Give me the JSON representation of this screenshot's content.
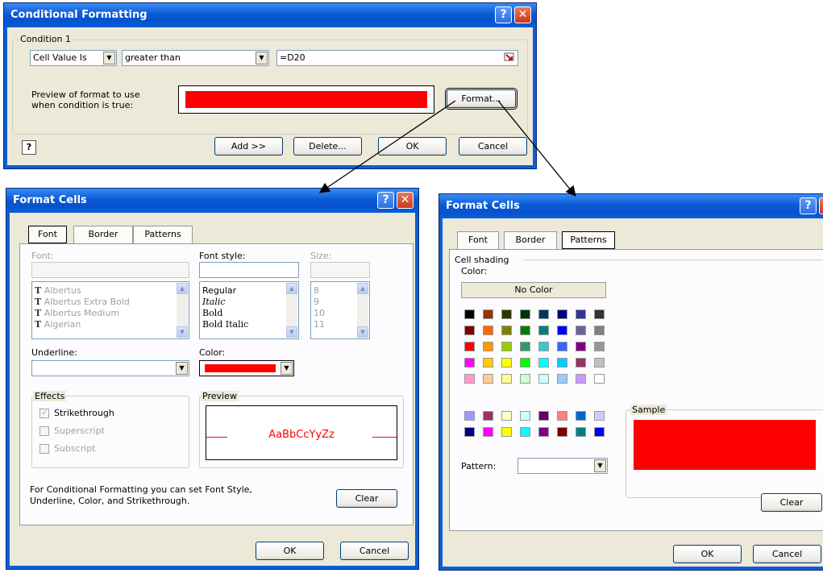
{
  "colors": {
    "accent_red": "#ff0000",
    "title_blue": "#0a5fd6",
    "dialog_bg": "#ece9d8"
  },
  "conditional_formatting": {
    "title": "Conditional Formatting",
    "help_glyph": "?",
    "close_glyph": "✕",
    "condition_label": "Condition 1",
    "operator_type": "Cell Value Is",
    "comparison": "greater than",
    "formula": "=D20",
    "preview_label_1": "Preview of format to use",
    "preview_label_2": "when condition is true:",
    "format_button": "Format...",
    "add_button": "Add >>",
    "delete_button": "Delete...",
    "ok_button": "OK",
    "cancel_button": "Cancel",
    "help_icon_glyph": "?"
  },
  "format_font": {
    "title": "Format Cells",
    "help_glyph": "?",
    "close_glyph": "✕",
    "tabs": [
      "Font",
      "Border",
      "Patterns"
    ],
    "font_label": "Font:",
    "font_style_label": "Font style:",
    "size_label": "Size:",
    "font_list": [
      "Albertus",
      "Albertus Extra Bold",
      "Albertus Medium",
      "Algerian"
    ],
    "font_glyph": "T",
    "style_list": [
      "Regular",
      "Italic",
      "Bold",
      "Bold Italic"
    ],
    "size_list": [
      "8",
      "9",
      "10",
      "11"
    ],
    "underline_label": "Underline:",
    "color_label": "Color:",
    "effects_label": "Effects",
    "strikethrough": "Strikethrough",
    "superscript": "Superscript",
    "subscript": "Subscript",
    "check_glyph": "✓",
    "preview_label": "Preview",
    "preview_text": "AaBbCcYyZz",
    "info_line_1": "For Conditional Formatting you can set Font Style,",
    "info_line_2": "Underline, Color, and Strikethrough.",
    "clear_button": "Clear",
    "ok_button": "OK",
    "cancel_button": "Cancel"
  },
  "format_patterns": {
    "title": "Format Cells",
    "help_glyph": "?",
    "close_glyph": "✕",
    "tabs": [
      "Font",
      "Border",
      "Patterns"
    ],
    "cell_shading_label": "Cell shading",
    "color_label": "Color:",
    "no_color_button": "No Color",
    "palette": [
      [
        "#000000",
        "#993300",
        "#333300",
        "#003300",
        "#003366",
        "#000080",
        "#333399",
        "#333333"
      ],
      [
        "#800000",
        "#ff6600",
        "#808000",
        "#008000",
        "#008080",
        "#0000ff",
        "#666699",
        "#808080"
      ],
      [
        "#ff0000",
        "#ff9900",
        "#99cc00",
        "#339966",
        "#33cccc",
        "#3366ff",
        "#800080",
        "#969696"
      ],
      [
        "#ff00ff",
        "#ffcc00",
        "#ffff00",
        "#00ff00",
        "#00ffff",
        "#00ccff",
        "#993366",
        "#c0c0c0"
      ],
      [
        "#ff99cc",
        "#ffcc99",
        "#ffff99",
        "#ccffcc",
        "#ccffff",
        "#99ccff",
        "#cc99ff",
        "#ffffff"
      ]
    ],
    "palette_extra": [
      [
        "#9999ff",
        "#993366",
        "#ffffcc",
        "#ccffff",
        "#660066",
        "#ff8080",
        "#0066cc",
        "#ccccff"
      ],
      [
        "#000080",
        "#ff00ff",
        "#ffff00",
        "#00ffff",
        "#800080",
        "#800000",
        "#008080",
        "#0000ff"
      ]
    ],
    "sample_label": "Sample",
    "pattern_label": "Pattern:",
    "clear_button": "Clear",
    "ok_button": "OK",
    "cancel_button": "Cancel"
  }
}
